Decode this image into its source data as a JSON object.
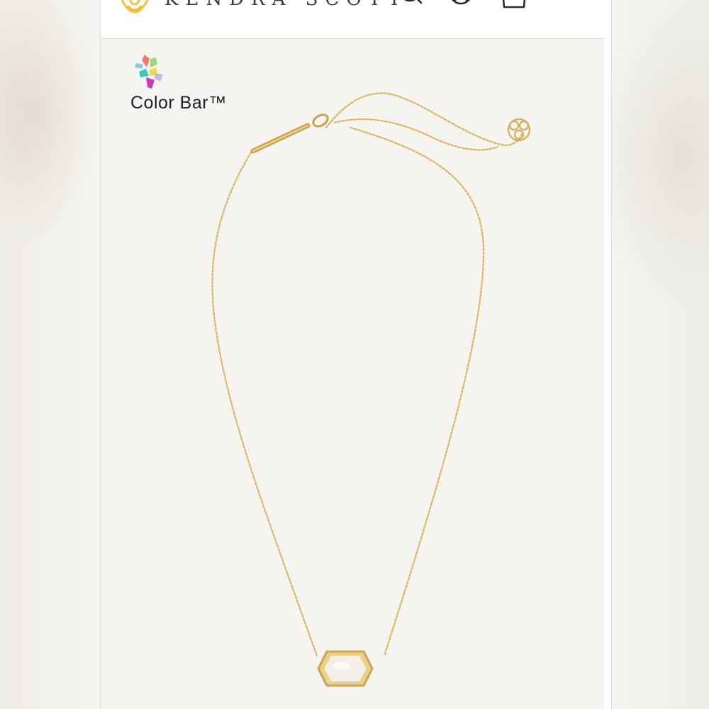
{
  "header": {
    "brand_name": "KENDRA SCOTT",
    "icons": [
      "kendra-scott-logo-icon",
      "search-icon",
      "account-icon",
      "cart-icon",
      "menu-icon"
    ]
  },
  "badge": {
    "label": "Color Bar™",
    "icon": "color-bar-logo-icon"
  },
  "product_image": {
    "subject": "necklace",
    "colors": {
      "gold": "#d9b45f",
      "stone": "#f2eee6"
    }
  },
  "colors": {
    "background": "#f6f4f1",
    "header_bg": "#ffffff",
    "logo_gold": "#f0c23a",
    "text": "#222222"
  }
}
